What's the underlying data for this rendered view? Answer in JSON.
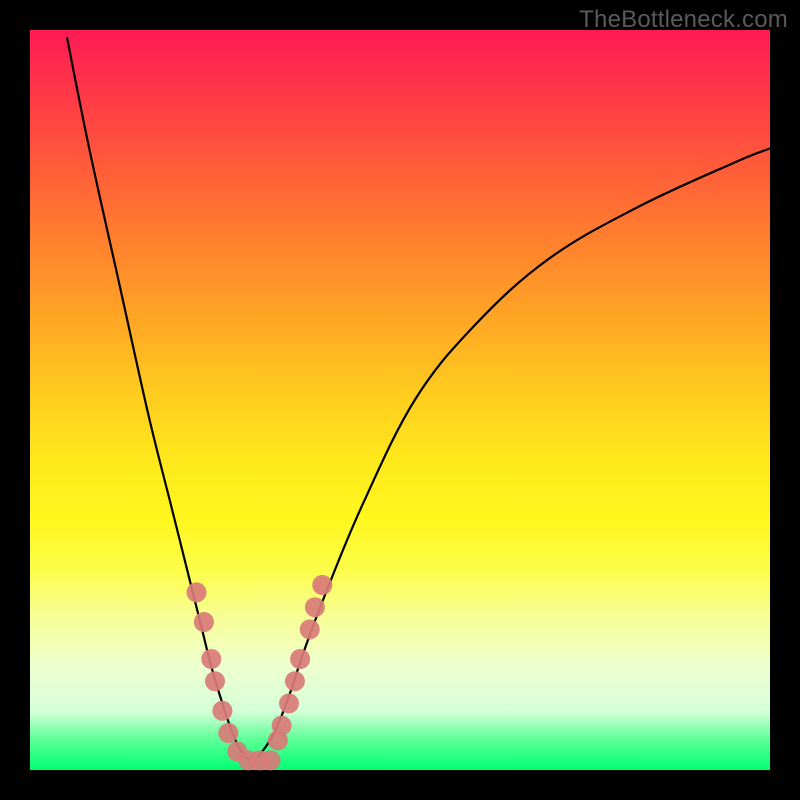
{
  "watermark": "TheBottleneck.com",
  "chart_data": {
    "type": "line",
    "title": "",
    "xlabel": "",
    "ylabel": "",
    "xlim": [
      0,
      100
    ],
    "ylim": [
      0,
      100
    ],
    "series": [
      {
        "name": "left-curve",
        "x": [
          5,
          8,
          12,
          16,
          19,
          21,
          23,
          24.5,
          26,
          27,
          28,
          29,
          30
        ],
        "values": [
          99,
          84,
          66,
          48,
          36,
          28,
          20,
          14,
          9,
          6,
          3.5,
          2,
          1
        ]
      },
      {
        "name": "right-curve",
        "x": [
          30,
          31,
          33,
          35,
          37,
          40,
          45,
          52,
          60,
          70,
          82,
          95,
          100
        ],
        "values": [
          1,
          2,
          5,
          10,
          16,
          24,
          36,
          50,
          60,
          69,
          76,
          82,
          84
        ]
      }
    ],
    "markers": {
      "name": "data-points",
      "color": "#d97b78",
      "points": [
        {
          "x": 22.5,
          "y": 24
        },
        {
          "x": 23.5,
          "y": 20
        },
        {
          "x": 24.5,
          "y": 15
        },
        {
          "x": 25.0,
          "y": 12
        },
        {
          "x": 26.0,
          "y": 8
        },
        {
          "x": 26.8,
          "y": 5
        },
        {
          "x": 28.0,
          "y": 2.5
        },
        {
          "x": 29.5,
          "y": 1.3
        },
        {
          "x": 31.0,
          "y": 1.3
        },
        {
          "x": 32.5,
          "y": 1.3
        },
        {
          "x": 33.5,
          "y": 4
        },
        {
          "x": 34.0,
          "y": 6
        },
        {
          "x": 35.0,
          "y": 9
        },
        {
          "x": 35.8,
          "y": 12
        },
        {
          "x": 36.5,
          "y": 15
        },
        {
          "x": 37.8,
          "y": 19
        },
        {
          "x": 38.5,
          "y": 22
        },
        {
          "x": 39.5,
          "y": 25
        }
      ]
    },
    "gradient_stops": [
      {
        "offset": 0.0,
        "color": "#ff1a54"
      },
      {
        "offset": 0.5,
        "color": "#ffd81d"
      },
      {
        "offset": 0.8,
        "color": "#fbfe80"
      },
      {
        "offset": 1.0,
        "color": "#00ff73"
      }
    ]
  }
}
